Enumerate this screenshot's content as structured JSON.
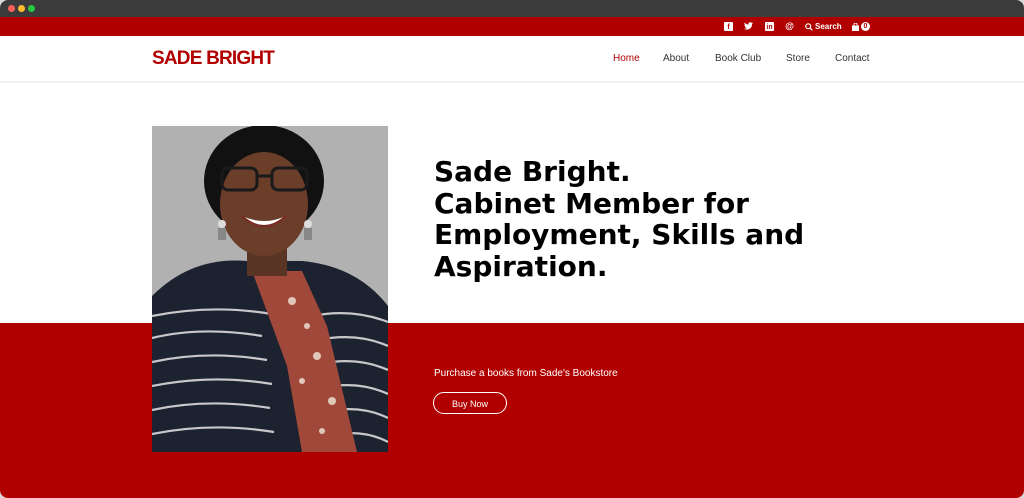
{
  "topbar": {
    "social_icons": [
      "facebook-icon",
      "twitter-icon",
      "linkedin-icon",
      "at-icon"
    ],
    "search_label": "Search",
    "cart_count": "0"
  },
  "header": {
    "logo": "SADE BRIGHT",
    "nav": [
      {
        "label": "Home",
        "active": true
      },
      {
        "label": "About",
        "active": false
      },
      {
        "label": "Book Club",
        "active": false
      },
      {
        "label": "Store",
        "active": false
      },
      {
        "label": "Contact",
        "active": false
      }
    ]
  },
  "hero": {
    "headline_lines": [
      "Sade Bright.",
      "Cabinet Member for",
      "Employment, Skills and",
      "Aspiration."
    ],
    "subtext": "Purchase a books from Sade's Bookstore",
    "button_label": "Buy Now"
  },
  "colors": {
    "brand_red": "#b00000",
    "white": "#ffffff",
    "text_dark": "#000000"
  }
}
